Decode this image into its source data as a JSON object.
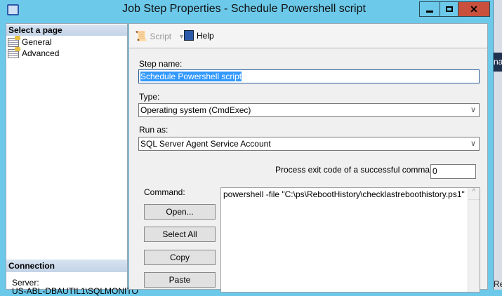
{
  "window": {
    "title": "Job Step Properties - Schedule Powershell script",
    "controls": {
      "minimize": "minimize-icon",
      "maximize": "maximize-icon",
      "close": "close-icon"
    },
    "close_color": "#c9503c",
    "frame_color": "#6cc9ea"
  },
  "desktop": {
    "partial_text": "nai",
    "bottom_text": "Re"
  },
  "left_panel": {
    "select_page_header": "Select a page",
    "pages": [
      {
        "label": "General"
      },
      {
        "label": "Advanced"
      }
    ],
    "connection_header": "Connection",
    "server_label": "Server:",
    "server_value": "US-ABL-DBAUTIL1\\SQLMONITO"
  },
  "toolbar": {
    "script_label": "Script",
    "help_label": "Help"
  },
  "form": {
    "step_name_label": "Step name:",
    "step_name_value": "Schedule Powershell script",
    "type_label": "Type:",
    "type_value": "Operating system (CmdExec)",
    "run_as_label": "Run as:",
    "run_as_value": "SQL Server Agent Service Account",
    "exit_code_label": "Process exit code of a successful command:",
    "exit_code_value": "0",
    "command_label": "Command:",
    "command_value": "powershell -file \"C:\\ps\\RebootHistory\\checklastreboothistory.ps1\"",
    "buttons": {
      "open": "Open...",
      "select_all": "Select All",
      "copy": "Copy",
      "paste": "Paste"
    }
  }
}
